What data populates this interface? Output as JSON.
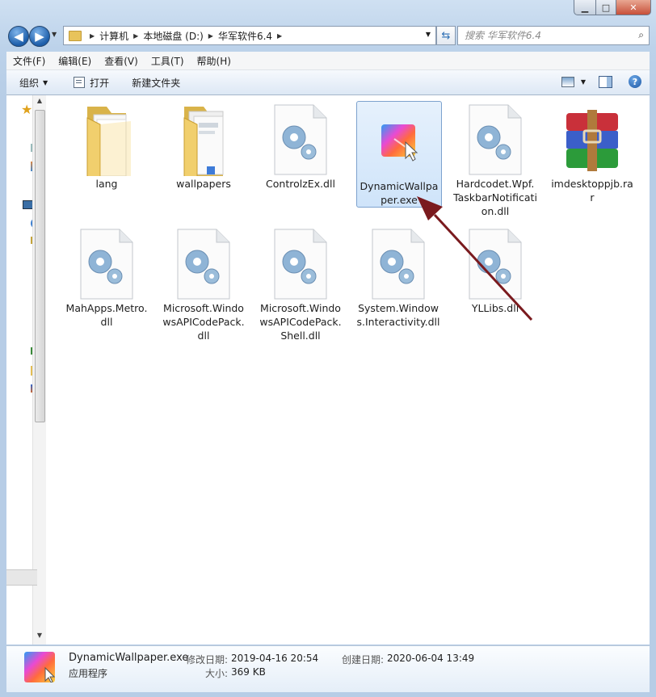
{
  "window": {
    "caption_buttons": {
      "minimize": "▁",
      "maximize": "□",
      "close": "✕"
    }
  },
  "nav": {
    "back_glyph": "◀",
    "forward_glyph": "▶",
    "breadcrumbs": [
      "计算机",
      "本地磁盘 (D:)",
      "华军软件6.4"
    ],
    "search_placeholder": "搜索 华军软件6.4"
  },
  "menu": [
    "文件(F)",
    "编辑(E)",
    "查看(V)",
    "工具(T)",
    "帮助(H)"
  ],
  "toolbar": {
    "organize": "组织",
    "open": "打开",
    "new_folder": "新建文件夹"
  },
  "files": [
    {
      "name": "lang",
      "icon": "folder-icon"
    },
    {
      "name": "wallpapers",
      "icon": "folder-icon"
    },
    {
      "name": "ControlzEx.dll",
      "icon": "dll-file-icon"
    },
    {
      "name": "DynamicWallpaper.exe",
      "icon": "app-icon",
      "selected": true
    },
    {
      "name": "Hardcodet.Wpf.TaskbarNotification.dll",
      "icon": "dll-file-icon"
    },
    {
      "name": "imdesktoppjb.rar",
      "icon": "rar-archive-icon"
    },
    {
      "name": "MahApps.Metro.dll",
      "icon": "dll-file-icon"
    },
    {
      "name": "Microsoft.WindowsAPICodePack.dll",
      "icon": "dll-file-icon"
    },
    {
      "name": "Microsoft.WindowsAPICodePack.Shell.dll",
      "icon": "dll-file-icon"
    },
    {
      "name": "System.Windows.Interactivity.dll",
      "icon": "dll-file-icon"
    },
    {
      "name": "YLLibs.dll",
      "icon": "dll-file-icon"
    }
  ],
  "details": {
    "name": "DynamicWallpaper.exe",
    "type": "应用程序",
    "modified_label": "修改日期:",
    "modified_value": "2019-04-16 20:54",
    "created_label": "创建日期:",
    "created_value": "2020-06-04 13:49",
    "size_label": "大小:",
    "size_value": "369 KB"
  },
  "colors": {
    "selection_bg": "#cfe4fa",
    "selection_border": "#7da2ce",
    "annotation_arrow": "#7a1a1e"
  }
}
